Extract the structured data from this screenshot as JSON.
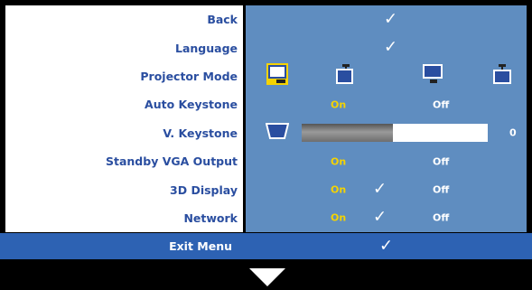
{
  "menu": {
    "back": {
      "label": "Back"
    },
    "language": {
      "label": "Language"
    },
    "projector_mode": {
      "label": "Projector Mode",
      "selected_index": 0,
      "icons": [
        "desktop-projector-icon",
        "ceiling-front-projector-icon",
        "rear-desktop-projector-icon",
        "ceiling-rear-projector-icon"
      ]
    },
    "auto_keystone": {
      "label": "Auto Keystone",
      "on": "On",
      "off": "Off"
    },
    "v_keystone": {
      "label": "V. Keystone",
      "value": "0",
      "fill_fraction": 0.49
    },
    "standby_vga": {
      "label": "Standby VGA Output",
      "on": "On",
      "off": "Off"
    },
    "display_3d": {
      "label": "3D Display",
      "on": "On",
      "off": "Off"
    },
    "network": {
      "label": "Network",
      "on": "On",
      "off": "Off"
    }
  },
  "exit": {
    "label": "Exit Menu"
  },
  "colors": {
    "label_text": "#2a4ea0",
    "value_bg": "#5f8dc0",
    "on_text": "#f5d300",
    "exit_bg": "#2d62b3"
  }
}
